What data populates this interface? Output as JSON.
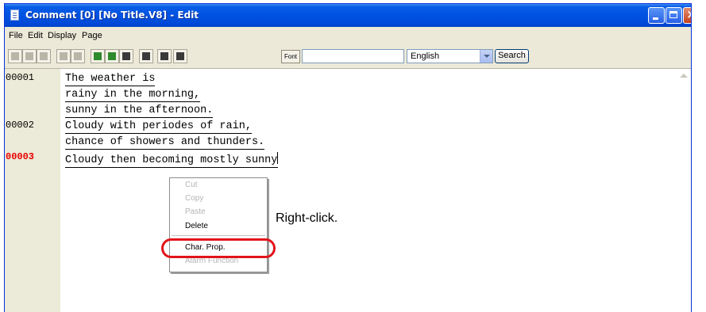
{
  "window": {
    "title": "Comment [0] [No Title.V8] - Edit"
  },
  "menu": {
    "items": [
      "File",
      "Edit",
      "Display",
      "Page"
    ]
  },
  "toolbar": {
    "font_label": "Font",
    "search_value": "",
    "language": "English",
    "search_label": "Search"
  },
  "editor": {
    "line_numbers": [
      "00001",
      "00002",
      "00003"
    ],
    "lines": [
      "The weather is",
      "rainy in the morning,",
      "sunny in the afternoon.",
      "Cloudy with periodes of rain,",
      "chance of showers and thunders.",
      "Cloudy then becoming mostly sunny"
    ]
  },
  "context_menu": {
    "items": [
      "Cut",
      "Copy",
      "Paste",
      "Delete",
      "Char. Prop.",
      "Alarm Function"
    ]
  },
  "annotation": {
    "text": "Right-click."
  },
  "colors": {
    "active_line_number": "#e80000",
    "highlight_ring": "#e2131a",
    "titlebar": "#0054e3"
  }
}
